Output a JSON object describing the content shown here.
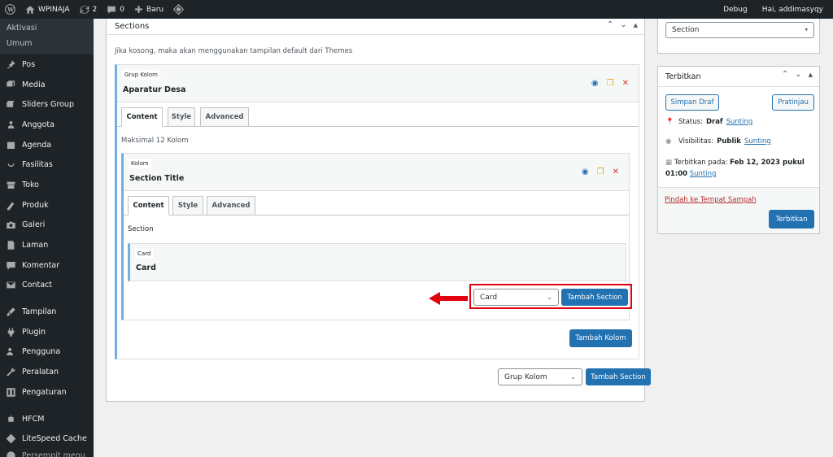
{
  "adminbar": {
    "site": "WPINAJA",
    "updates": "2",
    "comments": "0",
    "new": "Baru",
    "debug": "Debug",
    "greeting": "Hai, addimasyqy"
  },
  "sidebar": {
    "sub": [
      "Aktivasi",
      "Umum"
    ],
    "items": [
      {
        "label": "Pos",
        "icon": "pin-icon"
      },
      {
        "label": "Media",
        "icon": "media-icon"
      },
      {
        "label": "Sliders Group",
        "icon": "slider-icon"
      },
      {
        "label": "Anggota",
        "icon": "user-icon"
      },
      {
        "label": "Agenda",
        "icon": "calendar-icon"
      },
      {
        "label": "Fasilitas",
        "icon": "smile-icon"
      },
      {
        "label": "Toko",
        "icon": "store-icon"
      },
      {
        "label": "Produk",
        "icon": "product-icon"
      },
      {
        "label": "Galeri",
        "icon": "camera-icon"
      },
      {
        "label": "Laman",
        "icon": "page-icon"
      },
      {
        "label": "Komentar",
        "icon": "comment-icon"
      },
      {
        "label": "Contact",
        "icon": "mail-icon"
      }
    ],
    "items2": [
      {
        "label": "Tampilan",
        "icon": "brush-icon"
      },
      {
        "label": "Plugin",
        "icon": "plugin-icon"
      },
      {
        "label": "Pengguna",
        "icon": "users-icon"
      },
      {
        "label": "Peralatan",
        "icon": "wrench-icon"
      },
      {
        "label": "Pengaturan",
        "icon": "settings-icon"
      }
    ],
    "items3": [
      {
        "label": "HFCM",
        "icon": "robot-icon"
      },
      {
        "label": "LiteSpeed Cache",
        "icon": "diamond-icon"
      },
      {
        "label": "Persempit menu",
        "icon": "collapse-icon"
      }
    ]
  },
  "sections": {
    "title": "Sections",
    "desc": "Jika kosong, maka akan menggunakan tampilan default dari Themes",
    "group": {
      "tag": "Grup Kolom",
      "title": "Aparatur Desa",
      "tabs": [
        "Content",
        "Style",
        "Advanced"
      ],
      "max": "Maksimal 12 Kolom",
      "kolom": {
        "tag": "Kolom",
        "title": "Section Title",
        "tabs": [
          "Content",
          "Style",
          "Advanced"
        ],
        "section_label": "Section",
        "card": {
          "tag": "Card",
          "title": "Card"
        },
        "select": "Card",
        "add_section": "Tambah Section"
      },
      "add_kolom": "Tambah Kolom"
    },
    "bottom_select": "Grup Kolom",
    "bottom_add": "Tambah Section"
  },
  "right": {
    "type_select": "Section",
    "publish": {
      "title": "Terbitkan",
      "save_draft": "Simpan Draf",
      "preview": "Pratinjau",
      "status_label": "Status:",
      "status_value": "Draf",
      "visibility_label": "Visibilitas:",
      "visibility_value": "Publik",
      "edit": "Sunting",
      "published_label": "Terbitkan pada:",
      "published_value": "Feb 12, 2023 pukul",
      "published_time": "01:00",
      "trash": "Pindah ke Tempat Sampah",
      "publish_btn": "Terbitkan"
    }
  }
}
